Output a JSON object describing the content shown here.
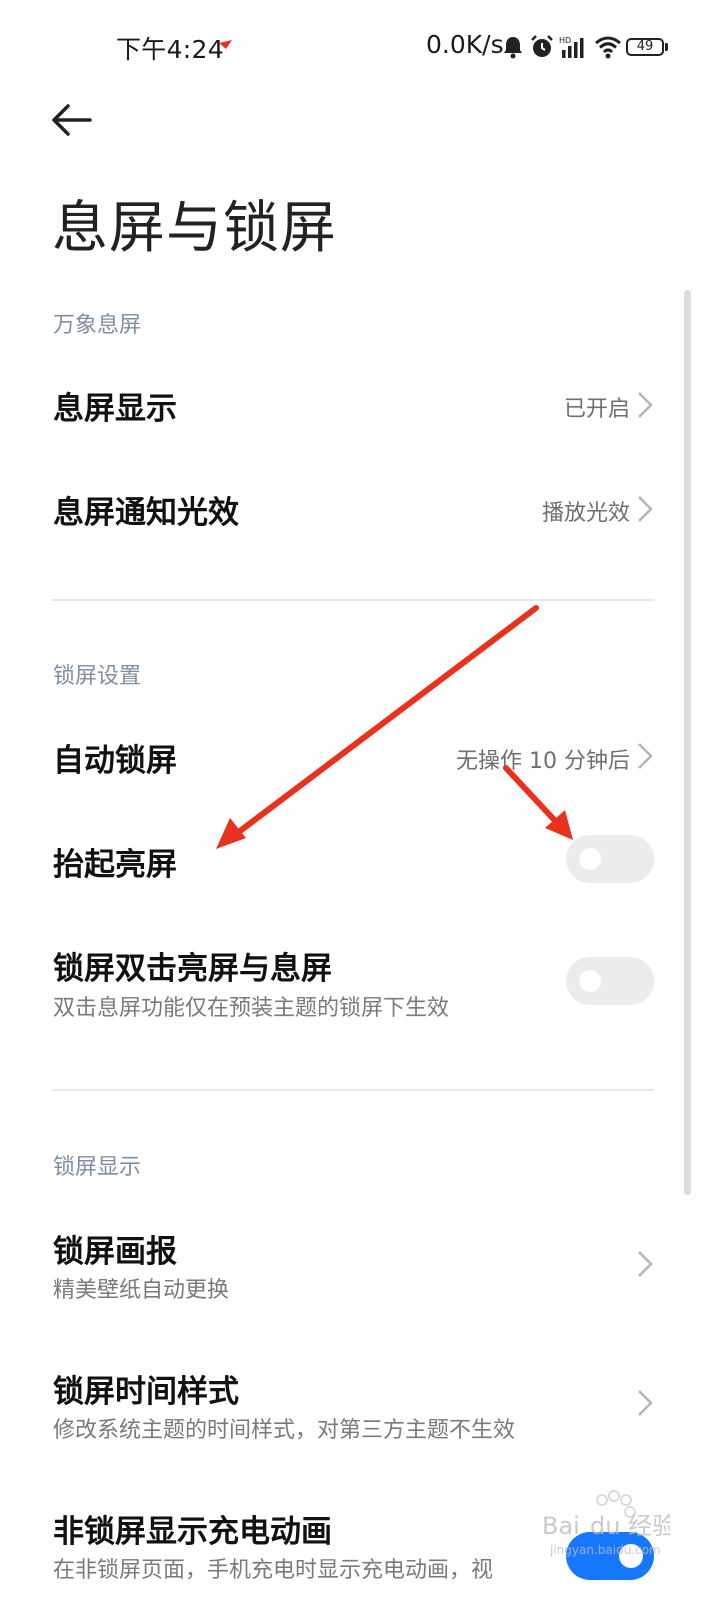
{
  "status_bar": {
    "time": "下午4:24",
    "net_speed": "0.0K/s",
    "battery": "49",
    "icons": [
      "notification-bell-icon",
      "alarm-clock-icon",
      "hd-signal-icon",
      "wifi-icon",
      "battery-icon"
    ]
  },
  "header": {
    "back_icon": "arrow-left-icon",
    "title": "息屏与锁屏"
  },
  "sections": {
    "aod": {
      "label": "万象息屏",
      "items": [
        {
          "title": "息屏显示",
          "value": "已开启"
        },
        {
          "title": "息屏通知光效",
          "value": "播放光效"
        }
      ]
    },
    "lock_settings": {
      "label": "锁屏设置",
      "auto_lock": {
        "title": "自动锁屏",
        "value": "无操作 10 分钟后"
      },
      "raise_to_wake": {
        "title": "抬起亮屏",
        "enabled": false
      },
      "double_tap": {
        "title": "锁屏双击亮屏与息屏",
        "subtitle": "双击息屏功能仅在预装主题的锁屏下生效",
        "enabled": false
      }
    },
    "lock_display": {
      "label": "锁屏显示",
      "items": [
        {
          "title": "锁屏画报",
          "subtitle": "精美壁纸自动更换"
        },
        {
          "title": "锁屏时间样式",
          "subtitle": "修改系统主题的时间样式，对第三方主题不生效"
        },
        {
          "title": "非锁屏显示充电动画",
          "subtitle": "在非锁屏页面，手机充电时显示充电动画，视",
          "enabled": true
        }
      ]
    }
  },
  "colors": {
    "accent": "#1677ff",
    "annotation_arrow": "#e8321e",
    "section_label": "#7d8ea6"
  },
  "watermark": {
    "brand": "Baidu 经验",
    "url": "jingyan.baidu.com"
  }
}
